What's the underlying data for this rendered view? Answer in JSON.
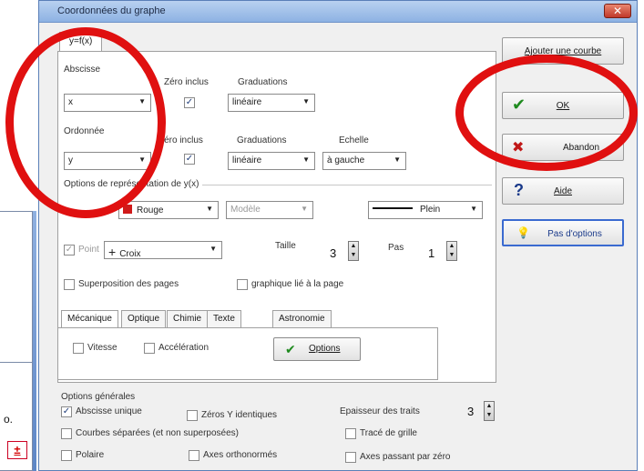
{
  "dialog": {
    "title": "Coordonnées du graphe",
    "close_label": "✕",
    "tab_label": "y=f(x)"
  },
  "abscisse": {
    "label": "Abscisse",
    "zero_label": "Zéro inclus",
    "grad_label": "Graduations",
    "variable": "x",
    "graduation": "linéaire"
  },
  "ordonnee": {
    "label": "Ordonnée",
    "zero_label": "Zéro inclus",
    "grad_label": "Graduations",
    "echelle_label": "Echelle",
    "variable": "y",
    "graduation": "linéaire",
    "echelle": "à gauche"
  },
  "representation": {
    "header": "Options de représentation de y(x)",
    "color": "Rouge",
    "color_hex": "#d01a1a",
    "model": "Modèle",
    "line_style": "Plein",
    "point_label": "Point",
    "point_shape": "Croix",
    "taille_label": "Taille",
    "taille_value": "3",
    "pas_label": "Pas",
    "pas_value": "1"
  },
  "options": {
    "superposition": "Superposition des pages",
    "graphique_lie": "graphique lié à la page"
  },
  "subtabs": [
    "Mécanique",
    "Optique",
    "Chimie",
    "Texte",
    "Astronomie"
  ],
  "mecanique": {
    "vitesse": "Vitesse",
    "acceleration": "Accélération",
    "options_button": "Options"
  },
  "general": {
    "header": "Options générales",
    "abscisse_unique": "Abscisse unique",
    "zeros_y": "Zéros Y identiques",
    "courbes_separees": "Courbes séparées (et non superposées)",
    "polaire": "Polaire",
    "axes_ortho": "Axes orthonormés",
    "epaisseur_label": "Epaisseur des traits",
    "epaisseur_value": "3",
    "trace_grille": "Tracé de grille",
    "axes_zero": "Axes passant par zéro"
  },
  "buttons": {
    "ajouter": "Ajouter une courbe",
    "ok": "OK",
    "abandon": "Abandon",
    "aide": "Aide",
    "pas_options": "Pas d'options"
  },
  "background": {
    "text": "o.",
    "button": "±"
  }
}
